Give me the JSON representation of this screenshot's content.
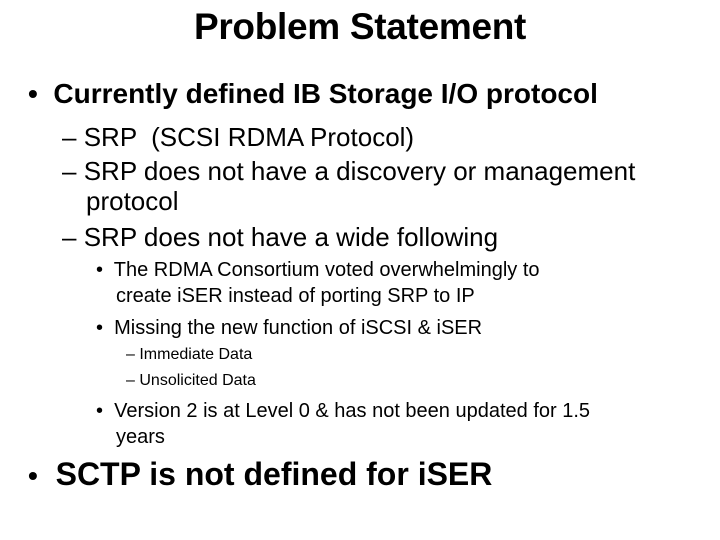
{
  "title": "Problem Statement",
  "bullets": {
    "b1": "Currently defined IB Storage I/O protocol",
    "b1_sub1": "SRP  (SCSI RDMA Protocol)",
    "b1_sub2_l1": "SRP does not have a discovery or management",
    "b1_sub2_l2": "protocol",
    "b1_sub3": "SRP does not have a wide following",
    "b1_sub3_a_l1": "The RDMA Consortium voted overwhelmingly to",
    "b1_sub3_a_l2": "create iSER instead of porting SRP to IP",
    "b1_sub3_b": "Missing the new function of iSCSI & iSER",
    "b1_sub3_b_i": "Immediate Data",
    "b1_sub3_b_ii": "Unsolicited Data",
    "b1_sub3_c_l1": "Version 2 is at Level 0 & has not been updated for 1.5",
    "b1_sub3_c_l2": "years",
    "b2": "SCTP is not defined for iSER"
  },
  "markers": {
    "bullet": "•",
    "dash": "–"
  }
}
